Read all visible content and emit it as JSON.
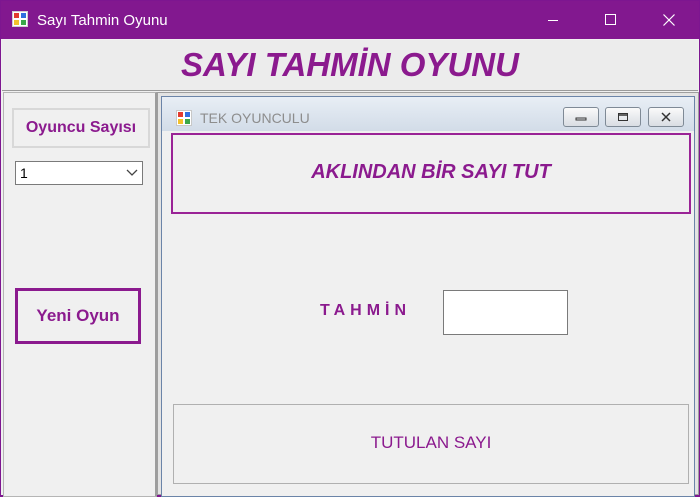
{
  "window": {
    "title": "Sayı Tahmin Oyunu",
    "icon": "app-form-icon",
    "controls": [
      "minimize-icon",
      "maximize-icon",
      "close-icon"
    ]
  },
  "header": {
    "title": "SAYI TAHMİN OYUNU"
  },
  "left_panel": {
    "players_label": "Oyuncu Sayısı",
    "players_select": {
      "value": "1"
    },
    "new_game_label": "Yeni Oyun"
  },
  "child_window": {
    "title": "TEK OYUNCULU",
    "banner": "AKLINDAN BİR SAYI TUT",
    "guess_label": "TAHMİN",
    "guess_value": "",
    "secret_label": "TUTULAN SAYI"
  },
  "colors": {
    "titlebar": "#82188f",
    "accent": "#8b1a8e",
    "background": "#f0f0f0"
  }
}
